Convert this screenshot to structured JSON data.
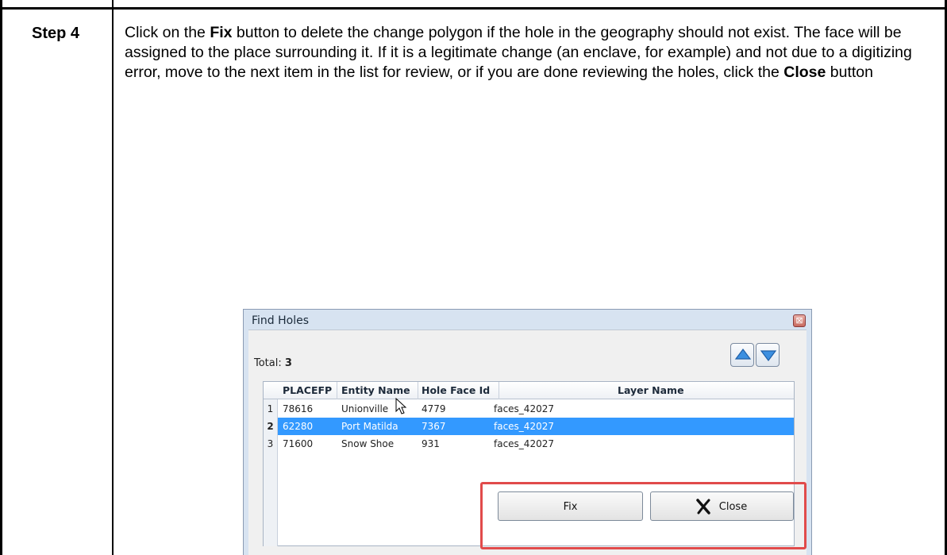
{
  "document": {
    "step_label": "Step 4",
    "instructions": {
      "part1": "Click on the ",
      "fix_word": "Fix",
      "part2": " button to delete the change polygon if the hole in the geography should not exist. The face will be assigned to the place surrounding it. If it is a legitimate change (an enclave, for example) and not due to a digitizing error, move to the next item in the list for review, or if you are done reviewing the holes, click the ",
      "close_word": "Close",
      "part3": " button"
    }
  },
  "dialog": {
    "title": "Find Holes",
    "close_glyph": "⊠",
    "total_label": "Total: ",
    "total_value": "3",
    "columns": [
      "PLACEFP",
      "Entity Name",
      "Hole Face Id",
      "Layer Name"
    ],
    "rows": [
      {
        "num": "1",
        "placefp": "78616",
        "entity": "Unionville",
        "hole_face_id": "4779",
        "layer": "faces_42027",
        "selected": false
      },
      {
        "num": "2",
        "placefp": "62280",
        "entity": "Port Matilda",
        "hole_face_id": "7367",
        "layer": "faces_42027",
        "selected": true
      },
      {
        "num": "3",
        "placefp": "71600",
        "entity": "Snow Shoe",
        "hole_face_id": "931",
        "layer": "faces_42027",
        "selected": false
      }
    ],
    "buttons": {
      "fix_label": "Fix",
      "close_label": "Close"
    },
    "icons": {
      "up": "move-up-icon",
      "down": "move-down-icon",
      "close": "close-x-icon"
    },
    "colors": {
      "selection": "#3399ff",
      "highlight_border": "#e14b4b"
    }
  }
}
